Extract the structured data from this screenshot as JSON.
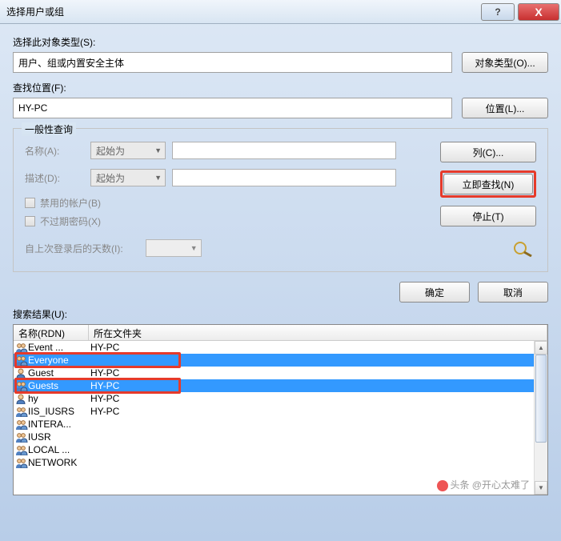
{
  "titlebar": {
    "title": "选择用户或组",
    "help": "?",
    "close": "X"
  },
  "objectType": {
    "label": "选择此对象类型(S):",
    "value": "用户、组或内置安全主体",
    "button": "对象类型(O)..."
  },
  "location": {
    "label": "查找位置(F):",
    "value": "HY-PC",
    "button": "位置(L)..."
  },
  "query": {
    "legend": "一般性查询",
    "nameLabel": "名称(A):",
    "nameMode": "起始为",
    "descLabel": "描述(D):",
    "descMode": "起始为",
    "chkDisabled": "禁用的帐户(B)",
    "chkNoExpire": "不过期密码(X)",
    "daysLabel": "自上次登录后的天数(I):",
    "btnColumns": "列(C)...",
    "btnFindNow": "立即查找(N)",
    "btnStop": "停止(T)"
  },
  "actions": {
    "ok": "确定",
    "cancel": "取消"
  },
  "results": {
    "label": "搜索结果(U):",
    "col1": "名称(RDN)",
    "col2": "所在文件夹",
    "rows": [
      {
        "name": "Event ...",
        "folder": "HY-PC",
        "type": "group",
        "selected": false
      },
      {
        "name": "Everyone",
        "folder": "",
        "type": "group",
        "selected": true
      },
      {
        "name": "Guest",
        "folder": "HY-PC",
        "type": "user",
        "selected": false
      },
      {
        "name": "Guests",
        "folder": "HY-PC",
        "type": "group",
        "selected": true
      },
      {
        "name": "hy",
        "folder": "HY-PC",
        "type": "user",
        "selected": false
      },
      {
        "name": "IIS_IUSRS",
        "folder": "HY-PC",
        "type": "group",
        "selected": false
      },
      {
        "name": "INTERA...",
        "folder": "",
        "type": "group",
        "selected": false
      },
      {
        "name": "IUSR",
        "folder": "",
        "type": "group",
        "selected": false
      },
      {
        "name": "LOCAL ...",
        "folder": "",
        "type": "group",
        "selected": false
      },
      {
        "name": "NETWORK",
        "folder": "",
        "type": "group",
        "selected": false
      }
    ]
  },
  "watermark": "头条 @开心太难了"
}
